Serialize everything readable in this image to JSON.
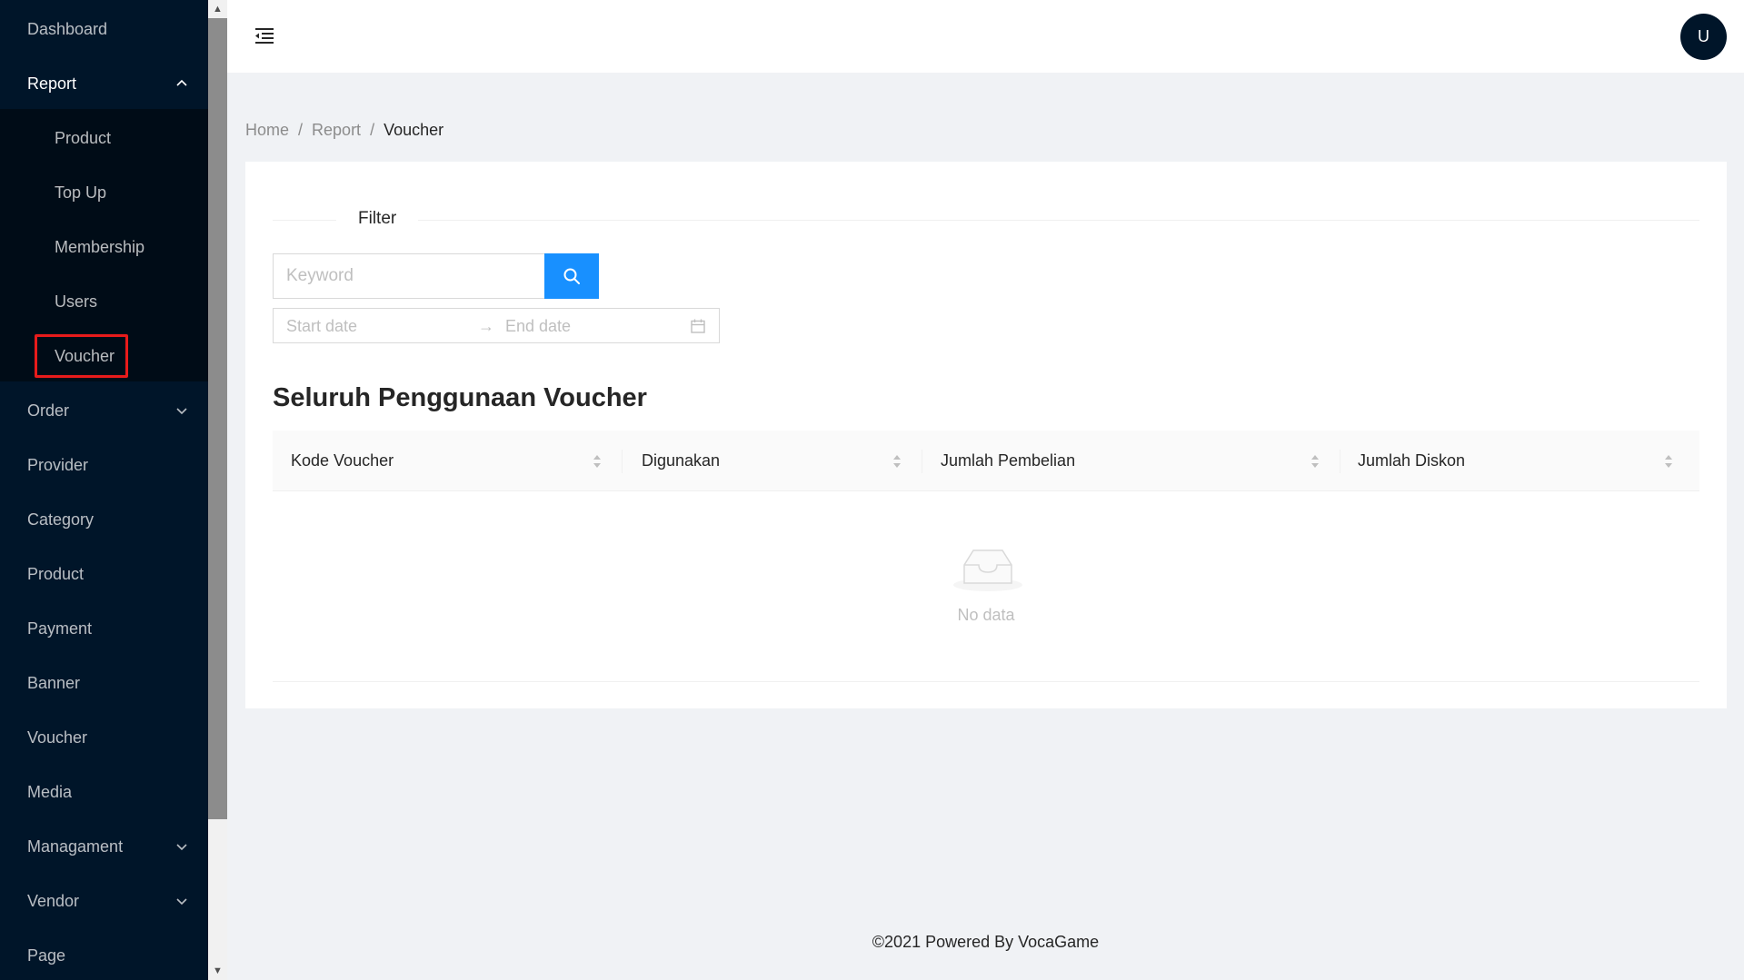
{
  "sidebar": {
    "items": [
      {
        "label": "Dashboard"
      },
      {
        "label": "Report"
      },
      {
        "label": "Product"
      },
      {
        "label": "Top Up"
      },
      {
        "label": "Membership"
      },
      {
        "label": "Users"
      },
      {
        "label": "Voucher"
      },
      {
        "label": "Order"
      },
      {
        "label": "Provider"
      },
      {
        "label": "Category"
      },
      {
        "label": "Product"
      },
      {
        "label": "Payment"
      },
      {
        "label": "Banner"
      },
      {
        "label": "Voucher"
      },
      {
        "label": "Media"
      },
      {
        "label": "Managament"
      },
      {
        "label": "Vendor"
      },
      {
        "label": "Page"
      }
    ]
  },
  "header": {
    "menu_icon": "menu-fold-icon",
    "avatar_initial": "U"
  },
  "breadcrumb": {
    "items": [
      "Home",
      "Report",
      "Voucher"
    ],
    "separator": "/"
  },
  "filter": {
    "label": "Filter",
    "keyword_placeholder": "Keyword",
    "start_date_placeholder": "Start date",
    "end_date_placeholder": "End date",
    "range_arrow": "→"
  },
  "main": {
    "title": "Seluruh Penggunaan Voucher",
    "columns": [
      "Kode Voucher",
      "Digunakan",
      "Jumlah Pembelian",
      "Jumlah Diskon"
    ],
    "empty_text": "No data"
  },
  "footer": {
    "text": "©2021 Powered By VocaGame"
  },
  "colors": {
    "sidebar_bg": "#001529",
    "submenu_bg": "#000c17",
    "primary": "#1890ff",
    "highlight": "#e81b1b"
  }
}
